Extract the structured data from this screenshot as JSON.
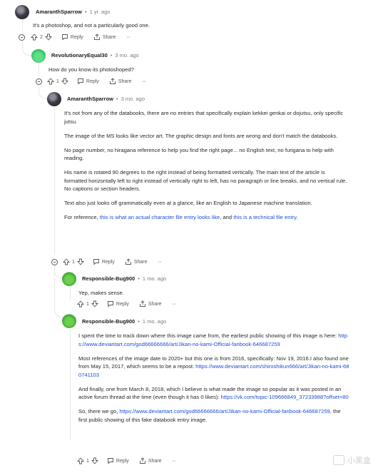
{
  "comments": [
    {
      "author": "AmaranthSparrow",
      "time": "1 yr. ago",
      "paragraphs": [
        "It's a photoshop, and not a particularly good one."
      ],
      "votes": "2",
      "reply_label": "Reply",
      "share_label": "Share",
      "more_label": "···"
    },
    {
      "author": "RevolutionaryEqual30",
      "time": "3 mo. ago",
      "paragraphs": [
        "How do you know its photoshoped?"
      ],
      "votes": "1",
      "reply_label": "Reply",
      "share_label": "Share",
      "more_label": "···"
    },
    {
      "author": "AmaranthSparrow",
      "time": "3 mo. ago",
      "paragraphs": [
        "It's not from any of the databooks, there are no entries that specifically explain kekkei genkai or dojutsu, only specific jutsu.",
        "The image of the MS looks like vector art. The graphic design and fonts are wrong and don't match the databooks.",
        "No page number, no hiragana reference to help you find the right page... no English text, no furigana to help with reading.",
        "His name is rotated 90 degrees to the right instead of being formatted vertically. The main text of the article is formatted horizontally left to right instead of vertically right to left, has no paragraph or line breaks, and no vertical rule. No captions or section headers.",
        "Text also just looks off grammatically even at a glance, like an English to Japanese machine translation."
      ],
      "ref_prefix": "For reference,",
      "ref_link1": "this is what an actual character file entry looks like",
      "ref_mid": ", and",
      "ref_link2": "this is a technical file entry",
      "ref_suffix": ".",
      "votes": "1",
      "reply_label": "Reply",
      "share_label": "Share",
      "more_label": "···"
    },
    {
      "author": "Responsible-Bug900",
      "time": "1 mo. ago",
      "paragraphs": [
        "Yep, makes sense."
      ],
      "votes": "1",
      "reply_label": "Reply",
      "share_label": "Share",
      "more_label": "···"
    },
    {
      "author": "Responsible-Bug900",
      "time": "1 mo. ago",
      "p1_text": "I spent the time to track down where this image came from, the earliest public showing of this image is here: ",
      "p1_url": "https://www.deviantart.com/god66666666/art/Jikan-no-kami-Official-fanbook-646687259",
      "p2_text": "Most references of the image date to 2020+ but this one is from 2016, specifically: Nov 19, 2016.I also found one from May 15, 2017, which seems to be a repost: ",
      "p2_url": "https://www.deviantart.com/shiroshikun666/art/Jikan-no-kami-680741103",
      "p3_text": "And finally, one from March 8, 2018, which I believe is what made the image so popular as it was posted in an active forum thread at the time (even though it has 0 likes): ",
      "p3_url": "https://vk.com/topic-109666849_37233988?offset=80",
      "p4_prefix": "So, there we go, ",
      "p4_url": "https://www.deviantart.com/god66666666/art/Jikan-no-kami-Official-fanbook-646687259",
      "p4_suffix": ", the first public showing of this fake databook entry image.",
      "votes": "1",
      "reply_label": "Reply",
      "share_label": "Share",
      "more_label": "···"
    }
  ],
  "watermark": "小黑盒"
}
